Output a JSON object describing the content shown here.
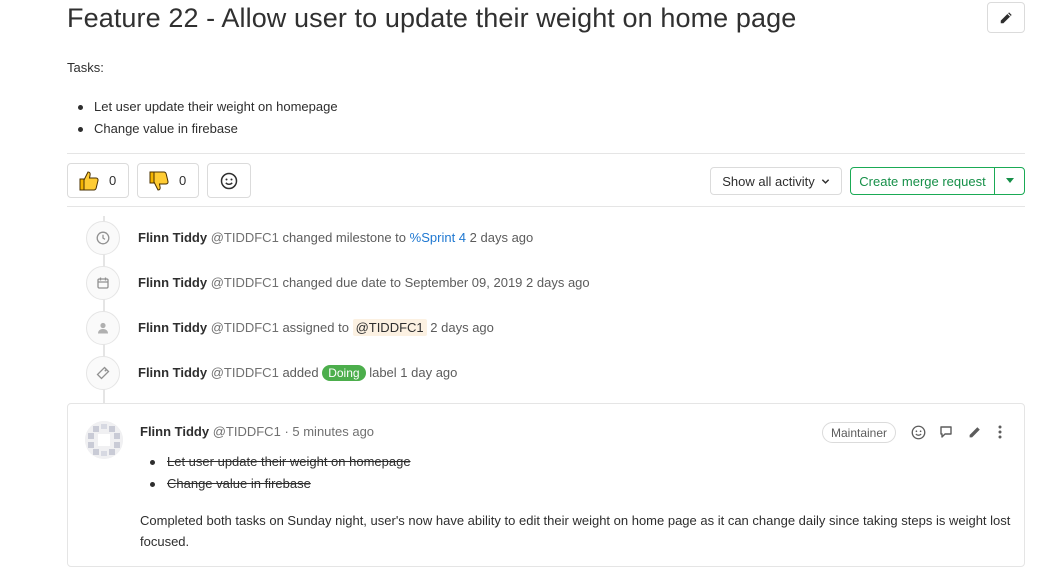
{
  "issue": {
    "title": "Feature 22 - Allow user to update their weight on home page",
    "tasks_label": "Tasks:",
    "tasks": [
      "Let user update their weight on homepage",
      "Change value in firebase"
    ]
  },
  "awards": {
    "thumbs_up_count": "0",
    "thumbs_down_count": "0"
  },
  "toolbar": {
    "show_activity_label": "Show all activity",
    "create_merge_label": "Create merge request"
  },
  "timeline": [
    {
      "author": "Flinn Tiddy",
      "handle": "@TIDDFC1",
      "pre": "changed milestone to",
      "ref": "%Sprint 4",
      "post": "2 days ago",
      "icon": "clock-icon"
    },
    {
      "author": "Flinn Tiddy",
      "handle": "@TIDDFC1",
      "pre": "changed due date to September 09, 2019",
      "post": "2 days ago",
      "icon": "calendar-icon"
    },
    {
      "author": "Flinn Tiddy",
      "handle": "@TIDDFC1",
      "pre": "assigned to",
      "ref": "@TIDDFC1",
      "post": "2 days ago",
      "icon": "user-icon"
    },
    {
      "author": "Flinn Tiddy",
      "handle": "@TIDDFC1",
      "pre": "added",
      "label": "Doing",
      "post": "label 1 day ago",
      "icon": "tag-icon"
    }
  ],
  "comment": {
    "author": "Flinn Tiddy",
    "handle": "@TIDDFC1",
    "time": "· 5 minutes ago",
    "role_badge": "Maintainer",
    "tasks": [
      "Let user update their weight on homepage",
      "Change value in firebase"
    ],
    "body": "Completed both tasks on Sunday night, user's now have ability to edit their weight on home page as it can change daily since taking steps is weight lost focused."
  },
  "colors": {
    "accent_green": "#1aaa55",
    "label_doing": "#4cae4c",
    "link_blue": "#1f78d1"
  }
}
